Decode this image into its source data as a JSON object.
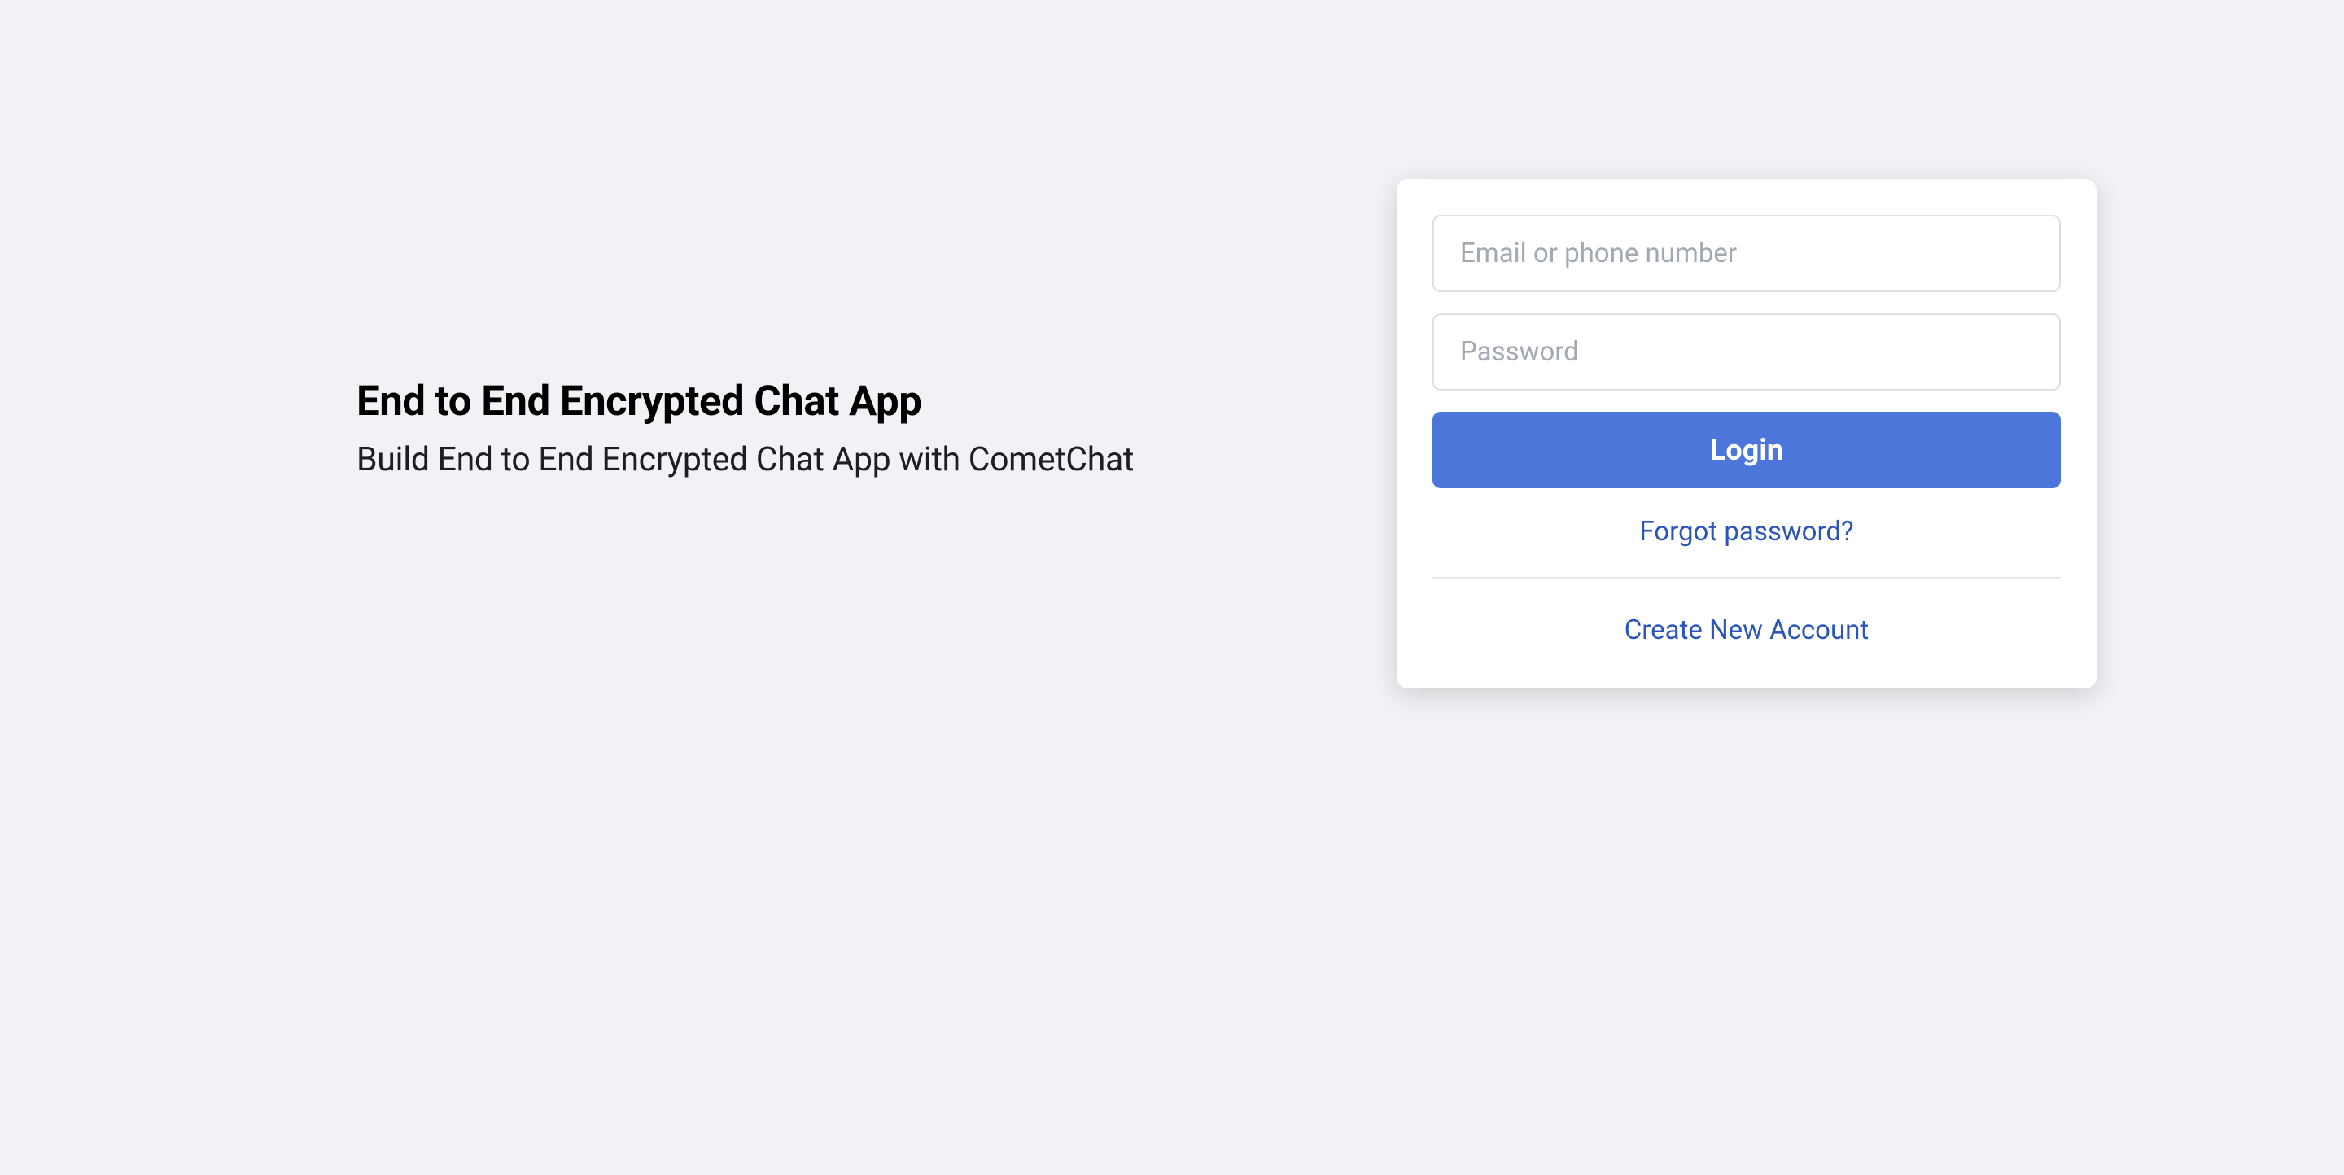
{
  "hero": {
    "headline": "End to End Encrypted Chat App",
    "subhead": "Build End to End Encrypted Chat App with CometChat"
  },
  "login": {
    "email_placeholder": "Email or phone number",
    "password_placeholder": "Password",
    "login_button_label": "Login",
    "forgot_password_label": "Forgot password?",
    "create_account_label": "Create New Account"
  }
}
